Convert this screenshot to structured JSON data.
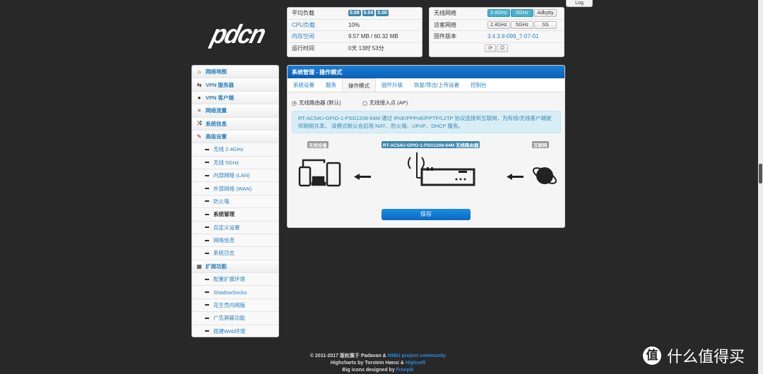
{
  "logo": "pdcn",
  "log_button": "Log",
  "status": {
    "rows": [
      {
        "label": "平均负载",
        "values": [
          "0.08",
          "0.04",
          "0.00"
        ]
      },
      {
        "label": "CPU负载",
        "value": "10%"
      },
      {
        "label": "内存空闲",
        "value": "9.57 MB / 60.32 MB"
      },
      {
        "label": "运行时间",
        "value": "0天 13时 53分"
      }
    ]
  },
  "network": {
    "wireless_label": "无线网络",
    "wireless_buttons": [
      "2.4GHz",
      "5GHz",
      "Adbyby"
    ],
    "guest_label": "访客网络",
    "guest_buttons": [
      "2.4GHz",
      "5GHz",
      "SS"
    ],
    "firmware_label": "固件版本",
    "firmware_value": "3.4.3.9-099_7-07-01"
  },
  "sidebar": {
    "items": [
      {
        "label": "网络地图",
        "icon": "home-icon"
      },
      {
        "label": "VPN 服务器",
        "icon": "retweet-icon"
      },
      {
        "label": "VPN 客户端",
        "icon": "globe-icon"
      },
      {
        "label": "网络流量",
        "icon": "list-icon"
      },
      {
        "label": "系统信息",
        "icon": "random-icon"
      },
      {
        "label": "高级设置",
        "icon": "wrench-icon"
      },
      {
        "label": "无线 2.4GHz"
      },
      {
        "label": "无线 5GHz"
      },
      {
        "label": "内部网络 (LAN)"
      },
      {
        "label": "外部网络 (WAN)"
      },
      {
        "label": "防火墙"
      },
      {
        "label": "系统管理"
      },
      {
        "label": "自定义设置"
      },
      {
        "label": "网络信息"
      },
      {
        "label": "系统日志"
      },
      {
        "label": "扩展功能",
        "icon": "th-icon"
      },
      {
        "label": "配置扩展环境"
      },
      {
        "label": "ShadowSocks"
      },
      {
        "label": "花生壳内网版"
      },
      {
        "label": "广告屏蔽功能"
      },
      {
        "label": "搭建Web环境"
      }
    ]
  },
  "main": {
    "title": "系统管理 - 操作模式",
    "tabs": [
      "系统设置",
      "服务",
      "操作模式",
      "固件升级",
      "恢复/导出/上传设置",
      "控制台"
    ],
    "active_tab": "操作模式",
    "radio_router": "无线路由器 (默认)",
    "radio_ap": "无线接入点 (AP)",
    "selected_mode": "无线路由器 (默认)",
    "info": "RT-AC54U-GPIO-1-PSG1208-64M 通过 IPoE/PPPoE/PPTP/L2TP 协议连接到互联网，为有线/无线客户端提供网络共享。 该模式默认会启用 NAT、防火墙、UPnP、DHCP 服务。",
    "tag_devices": "无线设备",
    "tag_router": "RT-AC54U-GPIO-1-PSG1208-64M 无线路由器",
    "tag_internet": "互联网",
    "save": "保存"
  },
  "footer": {
    "line1_prefix": "© 2011-2017 版权属于 Padavan & ",
    "line1_link": "N56U project community",
    "line2_prefix": "Highcharts by Torstein Hønsi & ",
    "line2_link": "Highsoft",
    "line3_prefix": "Big icons designed by ",
    "line3_link": "Freepik"
  },
  "watermark": {
    "badge": "值",
    "text": "什么值得买"
  },
  "colors": {
    "accent": "#0a6fc8",
    "badge": "#3a87ad",
    "link": "#2a7fc1",
    "info_bg": "#d9edf7"
  }
}
